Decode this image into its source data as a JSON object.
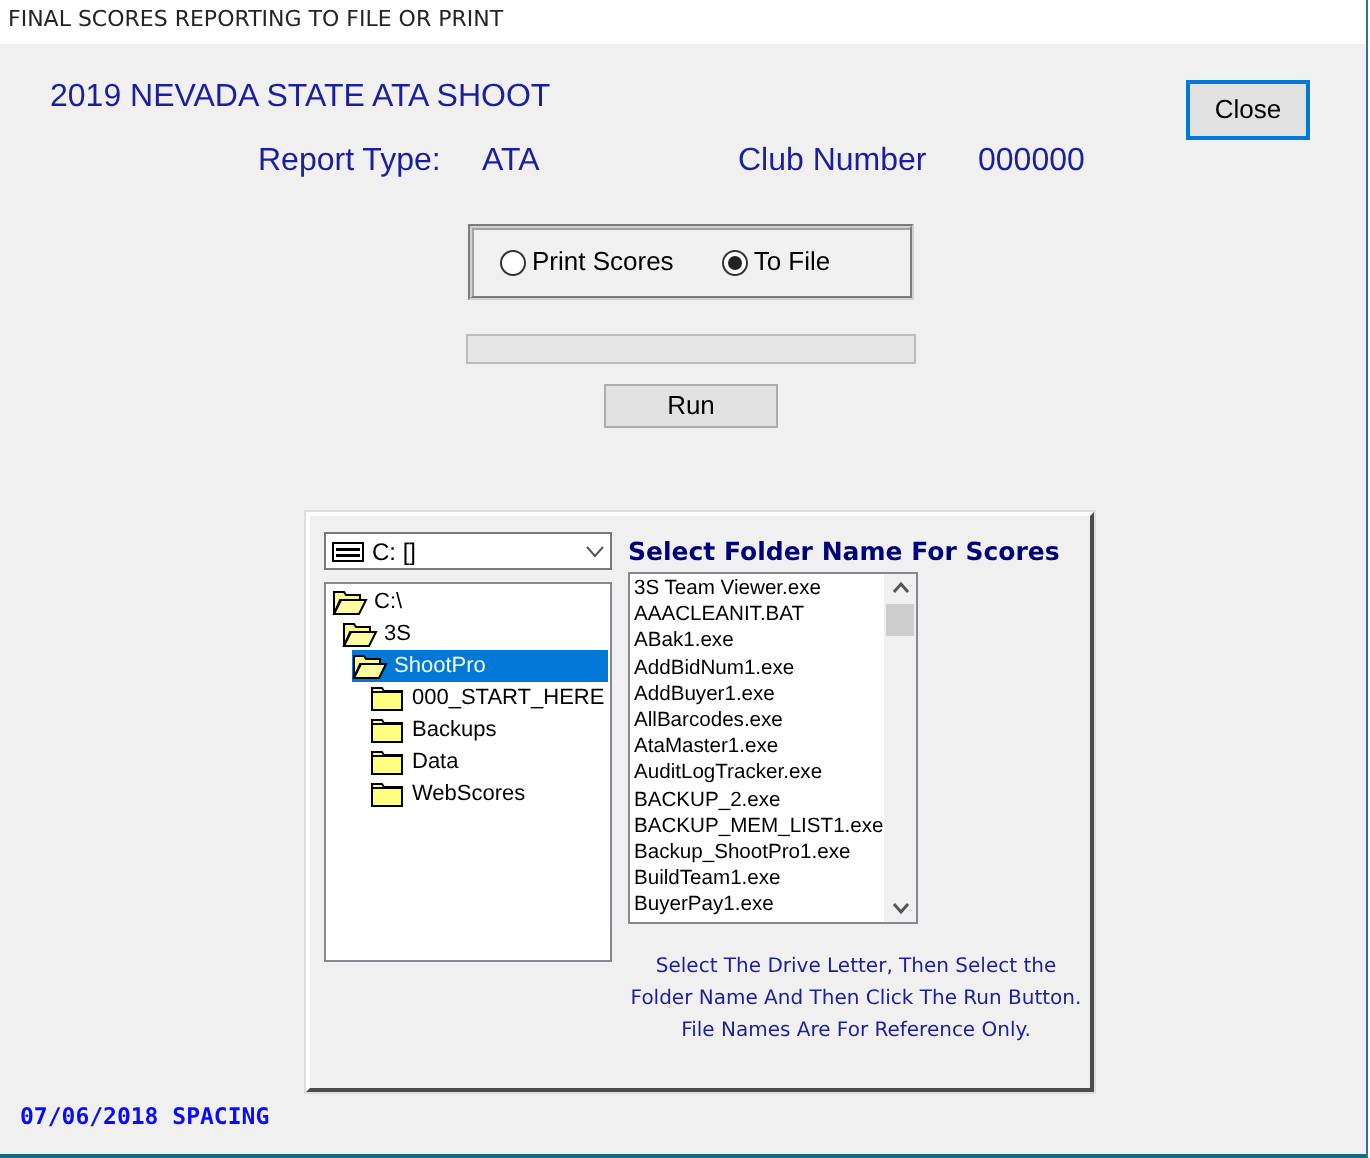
{
  "window": {
    "title": "FINAL SCORES REPORTING TO FILE OR PRINT"
  },
  "event_title": "2019 NEVADA STATE ATA SHOOT",
  "close_button": "Close",
  "report_type": {
    "label": "Report Type:",
    "value": "ATA"
  },
  "club_number": {
    "label": "Club Number",
    "value": "000000"
  },
  "output_options": [
    {
      "label": "Print Scores",
      "selected": false
    },
    {
      "label": "To File",
      "selected": true
    }
  ],
  "progress": {
    "level": 0
  },
  "run_button": "Run",
  "drive_select": {
    "value": "C: []"
  },
  "folder_tree": [
    {
      "label": "C:\\",
      "expanded": true,
      "selected": false,
      "children": [
        {
          "label": "3S",
          "expanded": true,
          "selected": false,
          "children": [
            {
              "label": "ShootPro",
              "expanded": true,
              "selected": true,
              "children": [
                {
                  "label": "000_START_HERE",
                  "expanded": false,
                  "selected": false
                },
                {
                  "label": "Backups",
                  "expanded": false,
                  "selected": false
                },
                {
                  "label": "Data",
                  "expanded": false,
                  "selected": false
                },
                {
                  "label": "WebScores",
                  "expanded": false,
                  "selected": false
                }
              ]
            }
          ]
        }
      ]
    }
  ],
  "files_heading": "Select Folder Name For Scores",
  "files": [
    "3S Team Viewer.exe",
    "AAACLEANIT.BAT",
    "ABak1.exe",
    "AddBidNum1.exe",
    "AddBuyer1.exe",
    "AllBarcodes.exe",
    "AtaMaster1.exe",
    "AuditLogTracker.exe",
    "BACKUP_2.exe",
    "BACKUP_MEM_LIST1.exe",
    "Backup_ShootPro1.exe",
    "BuildTeam1.exe",
    "BuyerPay1.exe"
  ],
  "instructions": [
    "Select The Drive Letter, Then Select the",
    "Folder Name And Then Click The Run Button.",
    "File Names Are For Reference Only."
  ],
  "footer": "07/06/2018 SPACING"
}
